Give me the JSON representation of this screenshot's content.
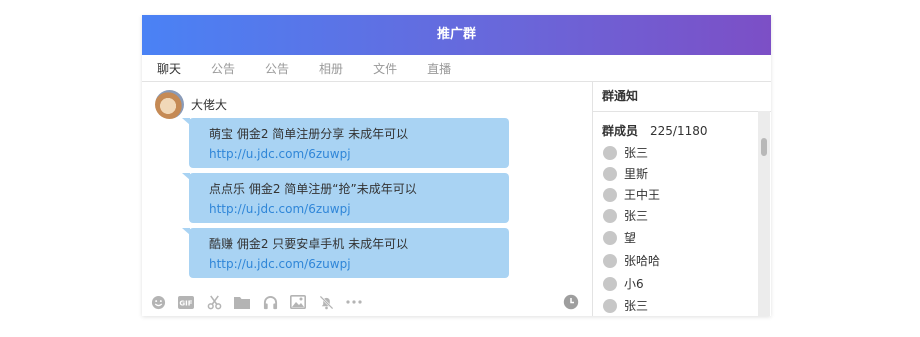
{
  "window": {
    "title": "推广群"
  },
  "tabs": [
    {
      "label": "聊天",
      "active": true
    },
    {
      "label": "公告",
      "active": false
    },
    {
      "label": "公告",
      "active": false
    },
    {
      "label": "相册",
      "active": false
    },
    {
      "label": "文件",
      "active": false
    },
    {
      "label": "直播",
      "active": false
    }
  ],
  "chat": {
    "sender_name": "大佬大",
    "messages": [
      {
        "text": "萌宝 佣金2 简单注册分享 未成年可以",
        "link": "http://u.jdc.com/6zuwpj"
      },
      {
        "text": "点点乐 佣金2 简单注册“抢”未成年可以",
        "link": "http://u.jdc.com/6zuwpj"
      },
      {
        "text": "酷赚 佣金2 只要安卓手机 未成年可以",
        "link": "http://u.jdc.com/6zuwpj"
      }
    ],
    "toolbar_icons": [
      "emoji-icon",
      "gif-icon",
      "scissors-icon",
      "folder-icon",
      "headphones-icon",
      "image-icon",
      "bell-off-icon",
      "more-icon"
    ],
    "history_icon": "clock-icon"
  },
  "sidebar": {
    "notice_title": "群通知",
    "members_label": "群成员",
    "members_count": "225/1180",
    "members": [
      "张三",
      "里斯",
      "王中王",
      "张三",
      "望",
      "张哈哈",
      "小6",
      "张三"
    ]
  },
  "colors": {
    "title_gradient_start": "#4a82f5",
    "title_gradient_end": "#7c4fc6",
    "bubble": "#a9d3f3",
    "link": "#2f86d8"
  }
}
